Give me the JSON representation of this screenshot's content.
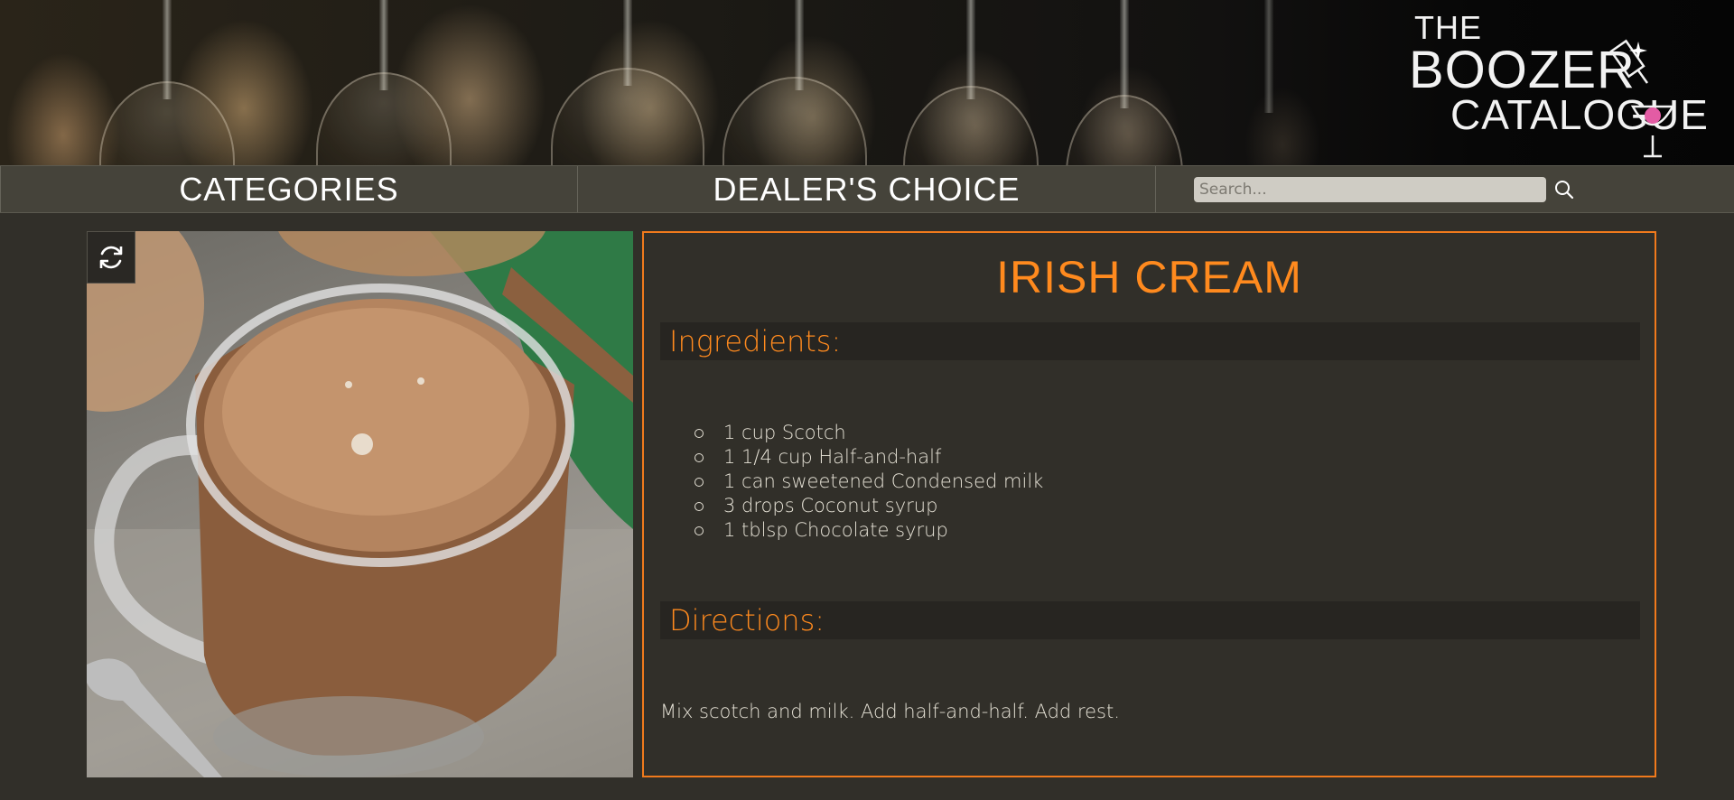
{
  "brand": {
    "logo_line1": "THE",
    "logo_line2": "BOOZER",
    "logo_line3": "CATALOGUE"
  },
  "nav": {
    "items": [
      {
        "label": "CATEGORIES"
      },
      {
        "label": "DEALER'S CHOICE"
      }
    ],
    "search": {
      "placeholder": "Search...",
      "icon": "search-icon"
    }
  },
  "recipe": {
    "title": "IRISH CREAM",
    "refresh_icon": "refresh-icon",
    "ingredients_heading": "Ingredients:",
    "ingredients": [
      "1 cup Scotch",
      "1 1/4 cup Half-and-half",
      "1 can sweetened Condensed milk",
      "3 drops Coconut syrup",
      "1 tblsp Chocolate syrup"
    ],
    "directions_heading": "Directions:",
    "directions": "Mix scotch and milk. Add half-and-half. Add rest."
  },
  "colors": {
    "accent": "#ff8a1e",
    "background": "#312f29",
    "navbar": "#45433a"
  }
}
